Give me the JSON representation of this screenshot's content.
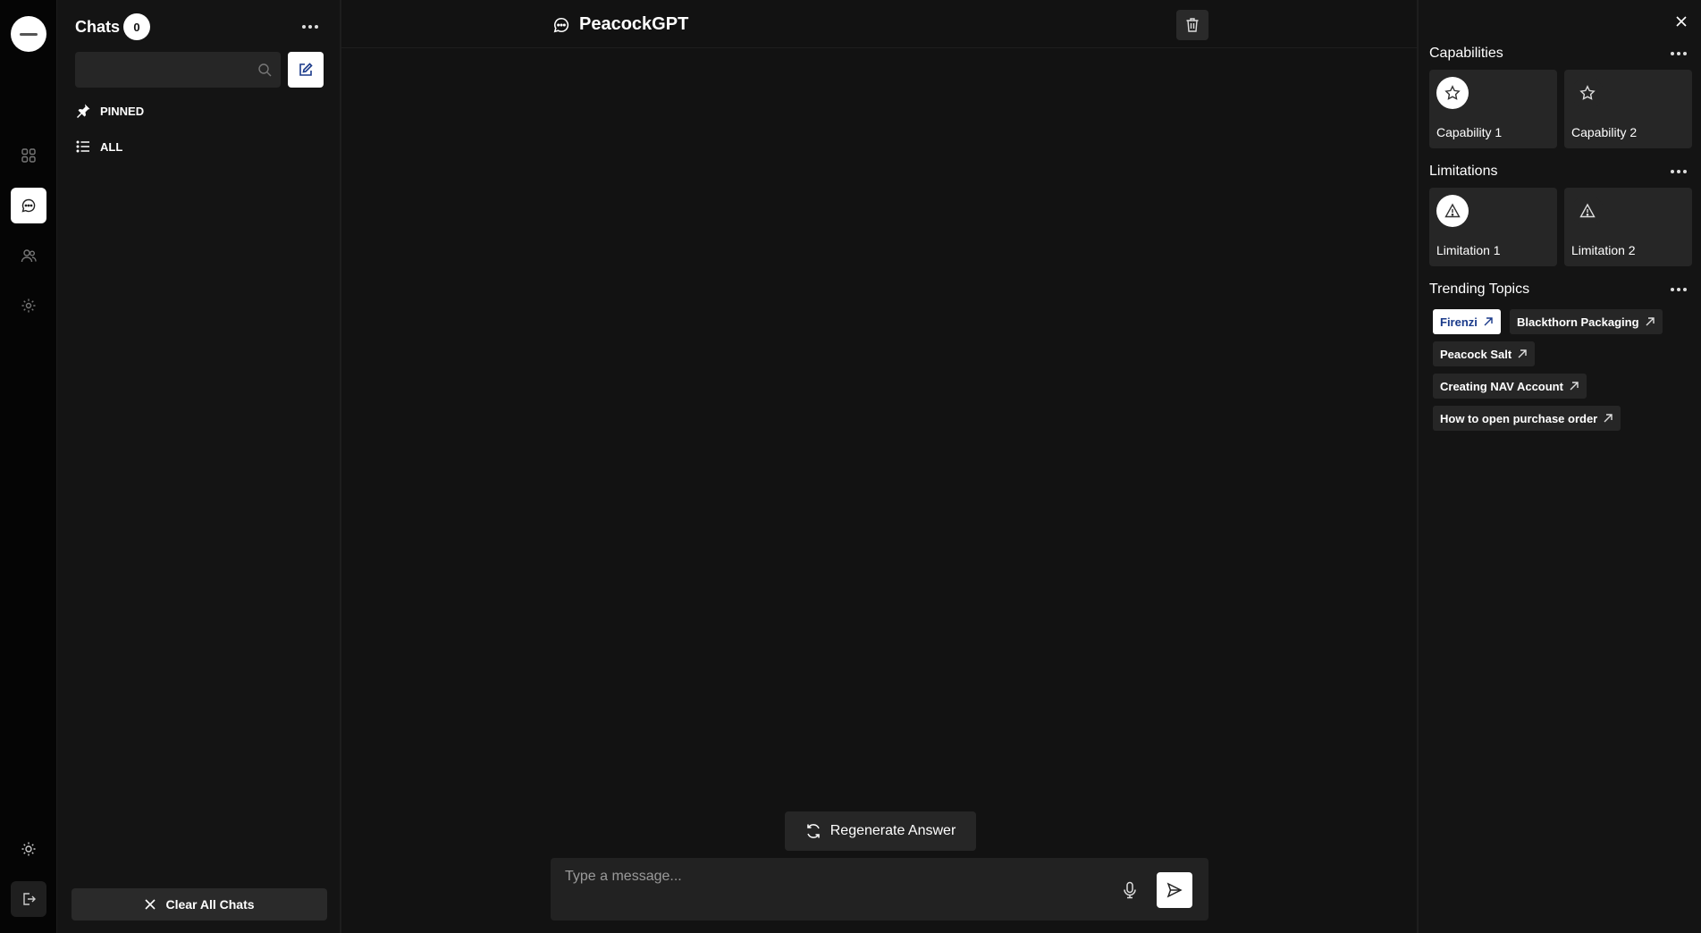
{
  "left_rail": {
    "items": [
      {
        "name": "dashboard",
        "icon": "grid-icon",
        "active": false
      },
      {
        "name": "chats",
        "icon": "chat-bubble-icon",
        "active": true
      },
      {
        "name": "users",
        "icon": "users-icon",
        "active": false
      },
      {
        "name": "settings",
        "icon": "gear-icon",
        "active": false
      }
    ],
    "bottom": [
      {
        "name": "theme",
        "icon": "sun-icon"
      },
      {
        "name": "logout",
        "icon": "logout-icon"
      }
    ]
  },
  "sidebar": {
    "title": "Chats",
    "chat_count": "0",
    "search_placeholder": "",
    "filters": [
      {
        "label": "PINNED",
        "icon": "pin-icon"
      },
      {
        "label": "ALL",
        "icon": "list-icon"
      }
    ],
    "clear_all_label": "Clear All Chats"
  },
  "main": {
    "title": "PeacockGPT",
    "regenerate_label": "Regenerate Answer",
    "message_placeholder": "Type a message..."
  },
  "right_panel": {
    "capabilities": {
      "title": "Capabilities",
      "items": [
        "Capability 1",
        "Capability 2"
      ]
    },
    "limitations": {
      "title": "Limitations",
      "items": [
        "Limitation 1",
        "Limitation 2"
      ]
    },
    "trending": {
      "title": "Trending Topics",
      "topics": [
        "Firenzi",
        "Blackthorn Packaging",
        "Peacock Salt",
        "Creating NAV Account",
        "How to open purchase order"
      ],
      "active_topic": "Firenzi"
    }
  },
  "colors": {
    "background": "#121212",
    "panel": "#141414",
    "rail": "#050505",
    "card": "#262626",
    "accent_text": "#1a3a8a"
  }
}
